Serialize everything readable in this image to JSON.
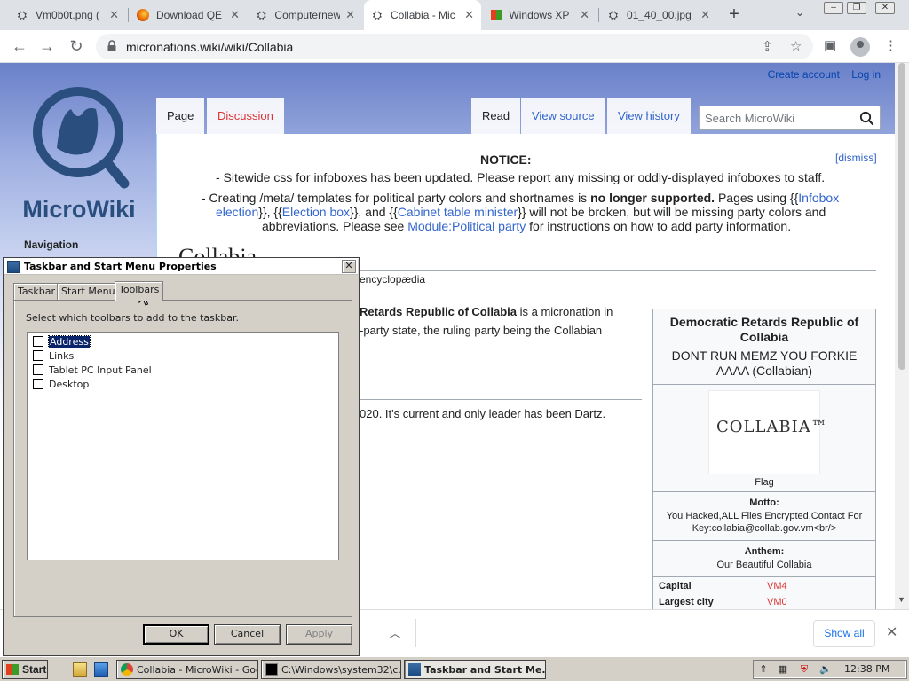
{
  "browser": {
    "tabs": [
      {
        "title": "Vm0b0t.png (",
        "icon": "github-icon"
      },
      {
        "title": "Download QE",
        "icon": "firefox-icon"
      },
      {
        "title": "Computernew",
        "icon": "github-icon"
      },
      {
        "title": "Collabia - Mic",
        "icon": "github-icon",
        "active": true
      },
      {
        "title": "Windows XP",
        "icon": "xp-icon"
      },
      {
        "title": "01_40_00.jpg",
        "icon": "github-icon"
      }
    ],
    "new_tab": "+",
    "url": "micronations.wiki/wiki/Collabia"
  },
  "wiki": {
    "logo_text": "MicroWiki",
    "nav_heading": "Navigation",
    "create_account": "Create account",
    "log_in": "Log in",
    "tab_page": "Page",
    "tab_discussion": "Discussion",
    "tab_read": "Read",
    "tab_view_source": "View source",
    "tab_view_history": "View history",
    "search_placeholder": "Search MicroWiki",
    "notice": {
      "title": "NOTICE:",
      "dismiss": "[dismiss]",
      "line1": "- Sitewide css for infoboxes has been updated. Please report any missing or oddly-displayed infoboxes to staff.",
      "line2_a": "- Creating /meta/ templates for political party colors and shortnames is ",
      "line2_bold": "no longer supported.",
      "line2_b": " Pages using {{",
      "link_infobox": "Infobox",
      "link_election": "election",
      "line3_a": "}}, {{",
      "link_election_box": "Election box",
      "line3_b": "}}, and {{",
      "link_cabinet": "Cabinet table minister",
      "line3_c": "}} will not be broken, but will be missing party colors and",
      "line4_a": "abbreviations. Please see ",
      "link_module": "Module:Political party",
      "line4_b": " for instructions on how to add party information."
    },
    "page_title": "Collabia",
    "tagline": "encyclopædia",
    "intro_bold": "Retards Republic of Collabia",
    "intro_rest": " is a micronation in",
    "intro_line2": "-party state, the ruling party being the Collabian",
    "history_line": "020. It's current and only leader has been Dartz.",
    "infobox": {
      "title": "Democratic Retards Republic of Collabia",
      "subtitle": "DONT RUN MEMZ YOU FORKIE AAAA (Collabian)",
      "flag_text": "COLLABIA™",
      "flag_caption": "Flag",
      "motto_label": "Motto:",
      "motto_value": "You Hacked,ALL Files Encrypted,Contact For Key:collabia@collab.gov.vm<br/>",
      "anthem_label": "Anthem:",
      "anthem_value": "Our Beautiful Collabia",
      "capital_label": "Capital",
      "capital_value": "VM4",
      "largest_label": "Largest city",
      "largest_value": "VM0"
    }
  },
  "downloads": {
    "show_all": "Show all"
  },
  "dialog": {
    "title": "Taskbar and Start Menu Properties",
    "tabs": [
      "Taskbar",
      "Start Menu",
      "Toolbars"
    ],
    "active_tab": "Toolbars",
    "instruction": "Select which toolbars to add to the taskbar.",
    "items": [
      {
        "label": "Address",
        "checked": false,
        "selected": true
      },
      {
        "label": "Links",
        "checked": false
      },
      {
        "label": "Tablet PC Input Panel",
        "checked": false
      },
      {
        "label": "Desktop",
        "checked": false
      }
    ],
    "ok": "OK",
    "cancel": "Cancel",
    "apply": "Apply"
  },
  "taskbar": {
    "start": "Start",
    "buttons": [
      {
        "label": "Collabia - MicroWiki - Goo...",
        "active": false
      },
      {
        "label": "C:\\Windows\\system32\\c...",
        "active": false
      },
      {
        "label": "Taskbar and Start Me...",
        "active": true
      }
    ],
    "clock": "12:38 PM"
  },
  "colors": {
    "link": "#3366cc",
    "red_link": "#dd3333",
    "xp_selection": "#0a246a"
  }
}
